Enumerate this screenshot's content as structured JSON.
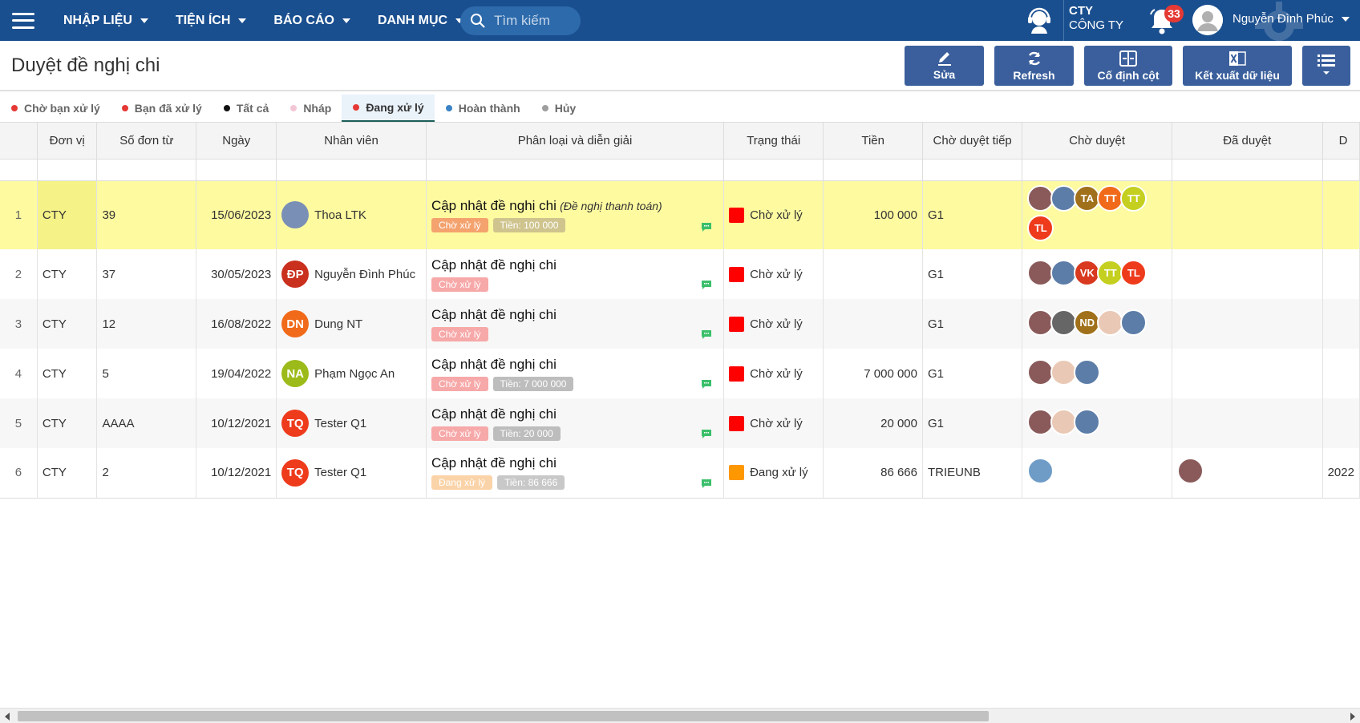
{
  "nav": {
    "items": [
      "NHẬP LIỆU",
      "TIỆN ÍCH",
      "BÁO CÁO",
      "DANH MỤC"
    ],
    "search_placeholder": "Tìm kiếm",
    "company_code": "CTY",
    "company_name": "CÔNG TY",
    "notification_count": "33",
    "user_name": "Nguyễn Đình Phúc"
  },
  "page": {
    "title": "Duyệt đề nghị chi",
    "toolbar": {
      "edit": "Sửa",
      "refresh": "Refresh",
      "freeze": "Cố định cột",
      "export": "Kết xuất dữ liệu"
    }
  },
  "tabs": [
    {
      "label": "Chờ bạn xử lý",
      "dot": "#e53935"
    },
    {
      "label": "Bạn đã xử lý",
      "dot": "#e53935"
    },
    {
      "label": "Tất cả",
      "dot": "#111111"
    },
    {
      "label": "Nháp",
      "dot": "#f3c6d3"
    },
    {
      "label": "Đang xử lý",
      "dot": "#e53935",
      "active": true
    },
    {
      "label": "Hoàn thành",
      "dot": "#3b83c6"
    },
    {
      "label": "Hủy",
      "dot": "#9e9e9e"
    }
  ],
  "columns": [
    "Đơn vị",
    "Số đơn từ",
    "Ngày",
    "Nhân viên",
    "Phân loại và diễn giải",
    "Trạng thái",
    "Tiền",
    "Chờ duyệt tiếp",
    "Chờ duyệt",
    "Đã duyệt",
    "D"
  ],
  "rows": [
    {
      "no": "1",
      "unit": "CTY",
      "doc": "39",
      "date": "15/06/2023",
      "employee": "Thoa LTK",
      "emp_initials": "",
      "emp_color": "#7a8fb5",
      "title": "Cập nhật đề nghị chi",
      "subtitle": "(Đề nghị thanh toán)",
      "status_pill": "Chờ xử lý",
      "status_pill_color": "#f4a26e",
      "amount_pill": "Tiền: 100 000",
      "amount_pill_color": "#cfc48e",
      "status": "Chờ xử lý",
      "status_color": "#ff0000",
      "amount": "100 000",
      "next": "G1",
      "pending": [
        {
          "t": "",
          "c": "#8a5a5a"
        },
        {
          "t": "",
          "c": "#5c7da8"
        },
        {
          "t": "TA",
          "c": "#a0701a"
        },
        {
          "t": "TT",
          "c": "#f06a1a"
        },
        {
          "t": "TT",
          "c": "#c4cf1f"
        },
        {
          "t": "TL",
          "c": "#ee3b1c"
        }
      ],
      "approved": [],
      "extra": ""
    },
    {
      "no": "2",
      "unit": "CTY",
      "doc": "37",
      "date": "30/05/2023",
      "employee": "Nguyễn Đình Phúc",
      "emp_initials": "ĐP",
      "emp_color": "#c9301e",
      "title": "Cập nhật đề nghị chi",
      "subtitle": "",
      "status_pill": "Chờ xử lý",
      "status_pill_color": "#f7a8a8",
      "amount_pill": "",
      "amount_pill_color": "",
      "status": "Chờ xử lý",
      "status_color": "#ff0000",
      "amount": "",
      "next": "G1",
      "pending": [
        {
          "t": "",
          "c": "#8a5a5a"
        },
        {
          "t": "",
          "c": "#5c7da8"
        },
        {
          "t": "VK",
          "c": "#d8391f"
        },
        {
          "t": "TT",
          "c": "#c4cf1f"
        },
        {
          "t": "TL",
          "c": "#ee3b1c"
        }
      ],
      "approved": [],
      "extra": ""
    },
    {
      "no": "3",
      "unit": "CTY",
      "doc": "12",
      "date": "16/08/2022",
      "employee": "Dung NT",
      "emp_initials": "DN",
      "emp_color": "#f06a1a",
      "title": "Cập nhật đề nghị chi",
      "subtitle": "",
      "status_pill": "Chờ xử lý",
      "status_pill_color": "#f7a8a8",
      "amount_pill": "",
      "amount_pill_color": "",
      "status": "Chờ xử lý",
      "status_color": "#ff0000",
      "amount": "",
      "next": "G1",
      "pending": [
        {
          "t": "",
          "c": "#8a5a5a"
        },
        {
          "t": "",
          "c": "#666666"
        },
        {
          "t": "ND",
          "c": "#a0701a"
        },
        {
          "t": "",
          "c": "#e9c9b5"
        },
        {
          "t": "",
          "c": "#5c7da8"
        }
      ],
      "approved": [],
      "extra": ""
    },
    {
      "no": "4",
      "unit": "CTY",
      "doc": "5",
      "date": "19/04/2022",
      "employee": "Phạm Ngọc An",
      "emp_initials": "NA",
      "emp_color": "#9cbb1a",
      "title": "Cập nhật đề nghị chi",
      "subtitle": "",
      "status_pill": "Chờ xử lý",
      "status_pill_color": "#f7a8a8",
      "amount_pill": "Tiền: 7 000 000",
      "amount_pill_color": "#bdbdbd",
      "status": "Chờ xử lý",
      "status_color": "#ff0000",
      "amount": "7 000 000",
      "next": "G1",
      "pending": [
        {
          "t": "",
          "c": "#8a5a5a"
        },
        {
          "t": "",
          "c": "#e9c9b5"
        },
        {
          "t": "",
          "c": "#5c7da8"
        }
      ],
      "approved": [],
      "extra": ""
    },
    {
      "no": "5",
      "unit": "CTY",
      "doc": "AAAA",
      "date": "10/12/2021",
      "employee": "Tester Q1",
      "emp_initials": "TQ",
      "emp_color": "#ee3b1c",
      "title": "Cập nhật đề nghị chi",
      "subtitle": "",
      "status_pill": "Chờ xử lý",
      "status_pill_color": "#f7a8a8",
      "amount_pill": "Tiền: 20 000",
      "amount_pill_color": "#bdbdbd",
      "status": "Chờ xử lý",
      "status_color": "#ff0000",
      "amount": "20 000",
      "next": "G1",
      "pending": [
        {
          "t": "",
          "c": "#8a5a5a"
        },
        {
          "t": "",
          "c": "#e9c9b5"
        },
        {
          "t": "",
          "c": "#5c7da8"
        }
      ],
      "approved": [],
      "extra": ""
    },
    {
      "no": "6",
      "unit": "CTY",
      "doc": "2",
      "date": "10/12/2021",
      "employee": "Tester Q1",
      "emp_initials": "TQ",
      "emp_color": "#ee3b1c",
      "title": "Cập nhật đề nghị chi",
      "subtitle": "",
      "status_pill": "Đang xử lý",
      "status_pill_color": "#fbd3a8",
      "amount_pill": "Tiền: 86 666",
      "amount_pill_color": "#c8c8c8",
      "status": "Đang xử lý",
      "status_color": "#ff9800",
      "amount": "86 666",
      "next": "TRIEUNB",
      "pending": [
        {
          "t": "",
          "c": "#6e9cc7"
        }
      ],
      "approved": [
        {
          "t": "",
          "c": "#8a5a5a"
        }
      ],
      "extra": "2022"
    }
  ]
}
